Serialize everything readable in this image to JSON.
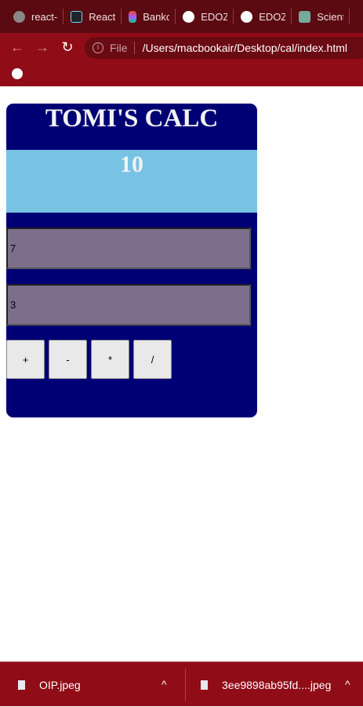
{
  "browser": {
    "tabs": [
      {
        "label": "react-",
        "icon": "globe-icon",
        "color": "#888888"
      },
      {
        "label": "React",
        "icon": "react-icon",
        "color": "#20232a"
      },
      {
        "label": "Banko",
        "icon": "figma-icon",
        "color": "#a259ff"
      },
      {
        "label": "EDOZ",
        "icon": "globe-icon",
        "color": "#ffffff"
      },
      {
        "label": "EDOZ",
        "icon": "globe-icon",
        "color": "#ffffff"
      },
      {
        "label": "Scient",
        "icon": "chatgpt-icon",
        "color": "#74aa9c"
      }
    ],
    "address": {
      "scheme_label": "File",
      "url": "/Users/macbookair/Desktop/cal/index.html"
    }
  },
  "calc": {
    "title": "TOMI'S CALC",
    "result": "10",
    "input1": "7",
    "input2": "3",
    "buttons": [
      "+",
      "-",
      "*",
      "/"
    ]
  },
  "downloads": [
    {
      "name": "OIP.jpeg"
    },
    {
      "name": "3ee9898ab95fd....jpeg"
    }
  ]
}
